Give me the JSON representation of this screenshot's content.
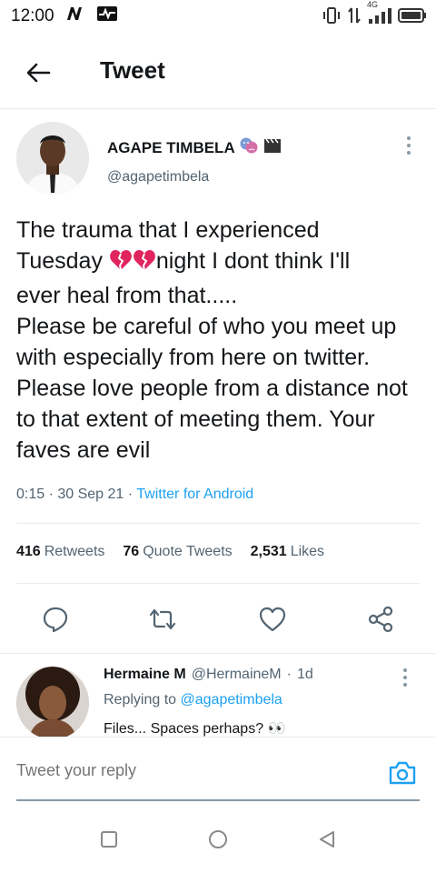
{
  "status_bar": {
    "time": "12:00",
    "network": "4G"
  },
  "header": {
    "title": "Tweet"
  },
  "tweet": {
    "author_name": "AGAPE TIMBELA",
    "author_handle": "@agapetimbela",
    "text_line1": "The trauma that I experienced",
    "text_line2a": "Tuesday ",
    "text_line2b": "night I dont think I'll",
    "text_rest": "ever heal from that.....\nPlease be careful of who you meet up with especially from here on twitter. Please love people from a distance not to that extent of meeting them. Your faves are evil",
    "time": "0:15",
    "date": "30 Sep 21",
    "source": "Twitter for Android",
    "retweets_count": "416",
    "retweets_label": "Retweets",
    "quote_count": "76",
    "quote_label": "Quote Tweets",
    "likes_count": "2,531",
    "likes_label": "Likes"
  },
  "reply": {
    "name": "Hermaine M",
    "handle": "@HermaineM",
    "age": "1d",
    "replying_prefix": "Replying to",
    "replying_to": "@agapetimbela",
    "text": "Files... Spaces perhaps? 👀"
  },
  "compose": {
    "placeholder": "Tweet your reply"
  },
  "colors": {
    "accent": "#1da1f2",
    "secondary_text": "#536471",
    "broken_heart": "#e0245e"
  }
}
